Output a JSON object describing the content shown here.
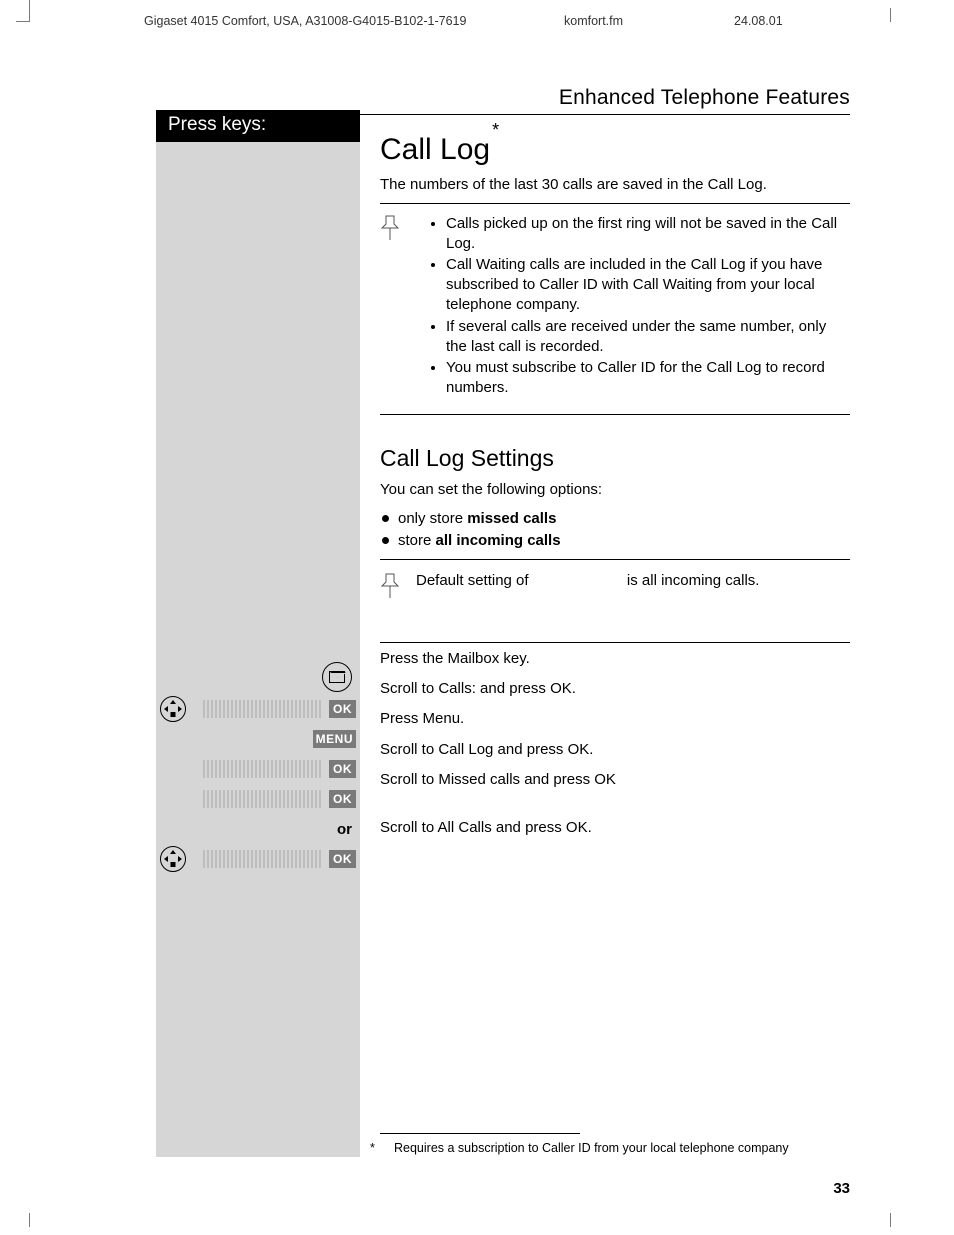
{
  "meta": {
    "doc_id": "Gigaset 4015 Comfort, USA, A31008-G4015-B102-1-7619",
    "center": "komfort.fm",
    "date": "24.08.01"
  },
  "header": {
    "section_title": "Enhanced Telephone Features"
  },
  "sidebar": {
    "title": "Press keys:",
    "ok_label": "OK",
    "menu_label": "MENU",
    "or_label": "or"
  },
  "content": {
    "h1": "Call Log",
    "h1_sup": "*",
    "intro": "The numbers of the last 30 calls are saved in the Call Log.",
    "tips": [
      "Calls picked up on the first ring will not be saved in the Call Log.",
      "Call Waiting calls are included in the Call Log if you have subscribed to Caller ID with Call Waiting from your local telephone company.",
      "If several calls are received under the same number, only the last call is recorded.",
      "You must subscribe to Caller ID for the Call Log to record numbers."
    ],
    "h2": "Call Log Settings",
    "options_intro": "You can set the following options:",
    "opt1_pre": "only store ",
    "opt1_bold": "missed calls",
    "opt2_pre": "store ",
    "opt2_bold": "all incoming calls",
    "default_pre": "Default setting of ",
    "default_gap": "",
    "default_post": "is all incoming calls.",
    "steps": [
      "Press the Mailbox key.",
      "Scroll to Calls: and press OK.",
      "Press Menu.",
      "Scroll to Call Log and press OK.",
      "Scroll to Missed calls and press OK",
      "Scroll to All Calls and press OK."
    ],
    "footnote_marker": "*",
    "footnote": "Requires a subscription to Caller ID from your local telephone company"
  },
  "page_number": "33"
}
